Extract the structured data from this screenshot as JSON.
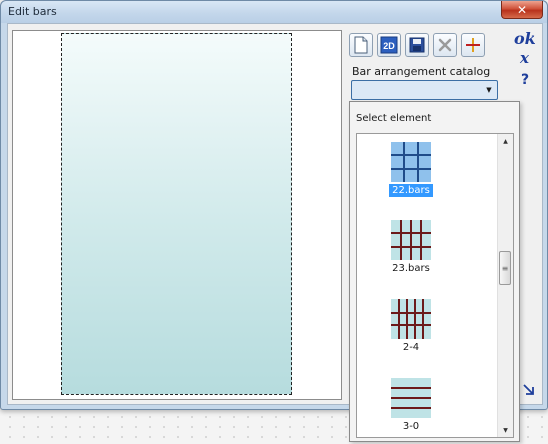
{
  "window": {
    "title": "Edit bars",
    "close_glyph": "✕"
  },
  "toolbar": {
    "buttons": [
      {
        "icon": "new-document-icon"
      },
      {
        "icon": "2d-view-icon",
        "text": "2D"
      },
      {
        "icon": "save-disk-icon"
      },
      {
        "icon": "delete-cross-icon"
      },
      {
        "icon": "add-bar-icon"
      }
    ]
  },
  "side": {
    "ok_label": "ok",
    "cancel_label": "x",
    "help_label": "?"
  },
  "catalog": {
    "label": "Bar arrangement catalog",
    "value": ""
  },
  "dropdown": {
    "title": "Select element",
    "items": [
      {
        "label": "22.bars",
        "selected": true
      },
      {
        "label": "23.bars",
        "selected": false
      },
      {
        "label": "2-4",
        "selected": false
      },
      {
        "label": "3-0",
        "selected": false
      }
    ]
  },
  "colors": {
    "selection": "#3399ff",
    "bar_line": "#6b1a1a",
    "thumb_fill": "#bfe3e6",
    "selected_thumb_fill": "#8fc1ec",
    "title_blue": "#1f3f9c"
  }
}
